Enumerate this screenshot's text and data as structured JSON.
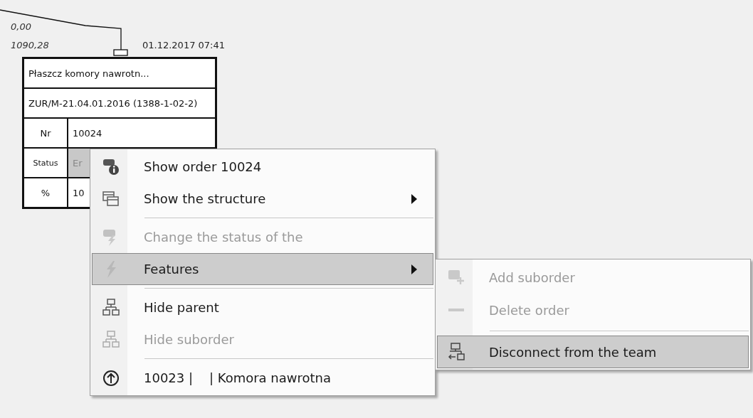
{
  "diagram": {
    "link_labels": [
      "0,00",
      "1090,28"
    ],
    "date": "01.12.2017 07:41",
    "node": {
      "title": "Płaszcz komory nawrotn...",
      "code": "ZUR/M-21.04.01.2016 (1388-1-02-2)",
      "fields": [
        {
          "label": "Nr",
          "value": "10024",
          "highlighted": false
        },
        {
          "label": "Status",
          "value": "Er",
          "highlighted": true
        },
        {
          "label": "%",
          "value": "10",
          "highlighted": false
        }
      ]
    }
  },
  "context_menu": {
    "items": [
      {
        "kind": "item",
        "label": "Show order 10024",
        "disabled": false,
        "selected": false,
        "submenu": false
      },
      {
        "kind": "item",
        "label": "Show the structure",
        "disabled": false,
        "selected": false,
        "submenu": true
      },
      {
        "kind": "separator"
      },
      {
        "kind": "item",
        "label": "Change the status of the",
        "disabled": true,
        "selected": false,
        "submenu": false
      },
      {
        "kind": "item",
        "label": "Features",
        "disabled": false,
        "selected": true,
        "submenu": true
      },
      {
        "kind": "separator"
      },
      {
        "kind": "item",
        "label": "Hide parent",
        "disabled": false,
        "selected": false,
        "submenu": false
      },
      {
        "kind": "item",
        "label": "Hide suborder",
        "disabled": true,
        "selected": false,
        "submenu": false
      },
      {
        "kind": "separator"
      },
      {
        "kind": "item",
        "label": "10023 |    | Komora nawrotna",
        "disabled": false,
        "selected": false,
        "submenu": false
      }
    ]
  },
  "submenu": {
    "items": [
      {
        "kind": "item",
        "label": "Add suborder",
        "disabled": true,
        "selected": false,
        "submenu": false
      },
      {
        "kind": "item",
        "label": "Delete order",
        "disabled": true,
        "selected": false,
        "submenu": false
      },
      {
        "kind": "separator"
      },
      {
        "kind": "item",
        "label": "Disconnect from the team",
        "disabled": false,
        "selected": true,
        "submenu": false
      }
    ]
  }
}
